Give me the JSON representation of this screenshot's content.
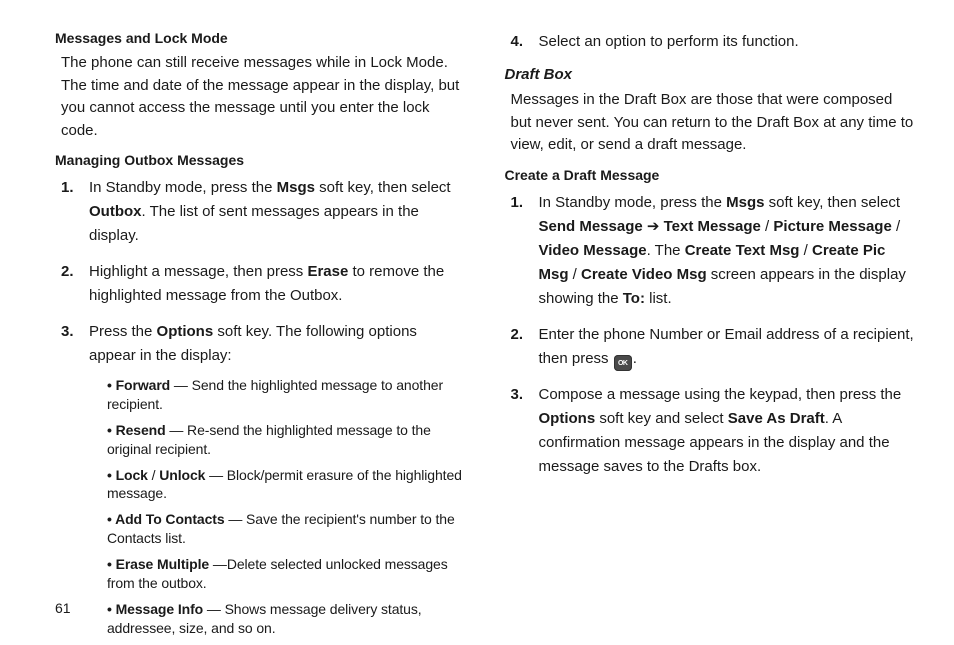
{
  "pageNumber": "61",
  "left": {
    "h1": "Messages and Lock Mode",
    "p1": "The phone can still receive messages while in Lock Mode. The time and date of the message appear in the display, but you cannot access the message until you enter the lock code.",
    "h2": "Managing Outbox Messages",
    "s1_a": "In Standby mode, press the ",
    "s1_b": "Msgs",
    "s1_c": " soft key, then select ",
    "s1_d": "Outbox",
    "s1_e": ". The list of sent messages appears in the display.",
    "s2_a": "Highlight a message, then press ",
    "s2_b": "Erase",
    "s2_c": " to remove the highlighted message from the Outbox.",
    "s3_a": "Press the ",
    "s3_b": "Options",
    "s3_c": " soft key. The following options appear in the display:",
    "o1_a": "Forward",
    "o1_b": " — Send the highlighted message to another recipient.",
    "o2_a": "Resend",
    "o2_b": " — Re-send the highlighted message to the original recipient.",
    "o3_a": "Lock",
    "o3_b": " / ",
    "o3_c": "Unlock",
    "o3_d": " — Block/permit erasure of the highlighted message.",
    "o4_a": "Add To Contacts",
    "o4_b": " — Save the recipient's number to the Contacts list.",
    "o5_a": "Erase Multiple",
    "o5_b": " —Delete selected unlocked messages from the outbox.",
    "o6_a": "Message Info",
    "o6_b": " — Shows message delivery status, addressee, size, and so on."
  },
  "right": {
    "s4": "Select an option to perform its function.",
    "h1": "Draft Box",
    "p1": "Messages in the Draft Box are those that were composed but never sent. You can return to the Draft Box at any time to view, edit, or send a draft message.",
    "h2": "Create a Draft Message",
    "s1_a": "In Standby mode, press the ",
    "s1_b": "Msgs",
    "s1_c": " soft key, then select ",
    "s1_d": "Send Message",
    "s1_e": " ➔ ",
    "s1_f": "Text Message",
    "s1_g": " / ",
    "s1_h": "Picture Message",
    "s1_i": " / ",
    "s1_j": "Video Message",
    "s1_k": ". The ",
    "s1_l": "Create Text Msg",
    "s1_m": " / ",
    "s1_n": "Create Pic Msg",
    "s1_o": " / ",
    "s1_p": "Create Video Msg",
    "s1_q": " screen appears in the display showing the ",
    "s1_r": "To:",
    "s1_s": " list.",
    "s2_a": "Enter the phone Number or Email address of a recipient, then press ",
    "s2_b": ".",
    "s3_a": "Compose a message using the keypad, then press the ",
    "s3_b": "Options",
    "s3_c": " soft key and select ",
    "s3_d": "Save As Draft",
    "s3_e": ". A confirmation message appears in the display and the message saves to the Drafts box."
  },
  "nums": {
    "n1": "1.",
    "n2": "2.",
    "n3": "3.",
    "n4": "4."
  },
  "okLabel": "OK"
}
